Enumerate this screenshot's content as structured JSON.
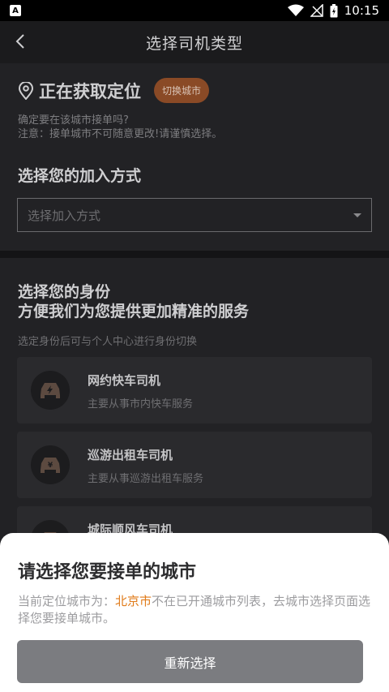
{
  "status_bar": {
    "left_icon": "A",
    "time": "10:15",
    "icons": [
      "wifi-icon",
      "signal-icon",
      "battery-icon"
    ]
  },
  "header": {
    "title": "选择司机类型"
  },
  "location": {
    "status_text": "正在获取定位",
    "switch_button": "切换城市",
    "confirm_line1": "确定要在该城市接单吗?",
    "confirm_line2": "注意：接单城市不可随意更改!请谨慎选择。"
  },
  "join": {
    "title": "选择您的加入方式",
    "placeholder": "选择加入方式"
  },
  "identity": {
    "title_line1": "选择您的身份",
    "title_line2": "方便我们为您提供更加精准的服务",
    "subtitle": "选定身份后可与个人中心进行身份切换",
    "cards": [
      {
        "name": "网约快车司机",
        "desc": "主要从事市内快车服务",
        "icon": "car-lightning-icon"
      },
      {
        "name": "巡游出租车司机",
        "desc": "主要从事巡游出租车服务",
        "icon": "car-yen-icon"
      },
      {
        "name": "城际顺风车司机",
        "desc": "",
        "icon": "car-icon"
      }
    ]
  },
  "sheet": {
    "title": "请选择您要接单的城市",
    "msg_prefix": "当前定位城市为：",
    "city": "北京市",
    "msg_suffix": "不在已开通城市列表，去城市选择页面选择您要接单城市。",
    "button": "重新选择"
  },
  "colors": {
    "accent_orange": "#e07b1a",
    "switch_bg": "#8a4a26",
    "button_gray": "#7b7c80"
  }
}
